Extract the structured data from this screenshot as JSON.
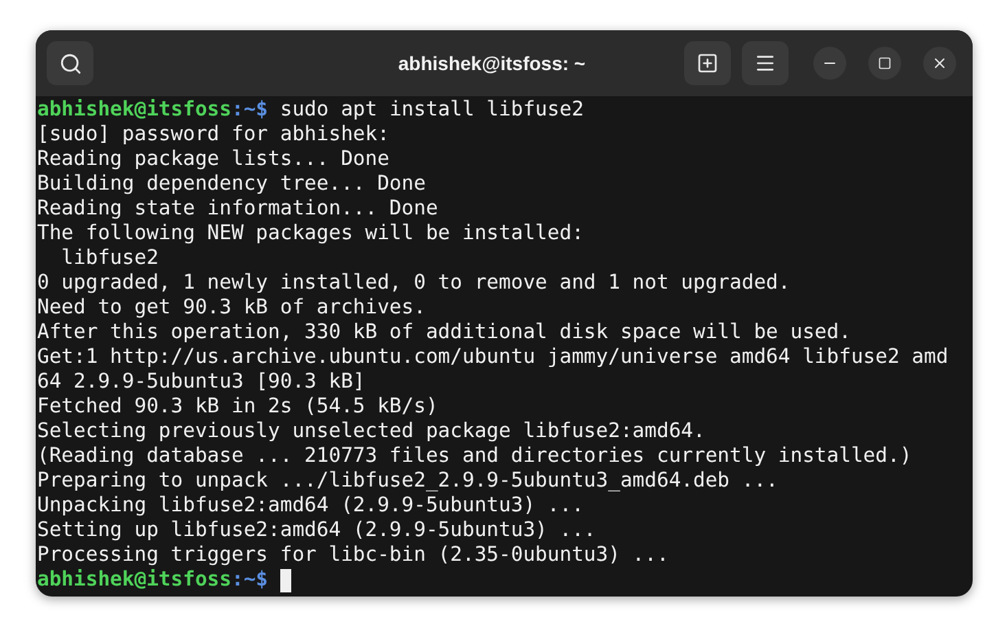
{
  "window": {
    "title": "abhishek@itsfoss: ~"
  },
  "terminal": {
    "lines": [
      {
        "kind": "prompt",
        "user_host": "abhishek@itsfoss",
        "path": ":~$",
        "command": " sudo apt install libfuse2",
        "cursor": false
      },
      {
        "kind": "output",
        "text": "[sudo] password for abhishek:"
      },
      {
        "kind": "output",
        "text": "Reading package lists... Done"
      },
      {
        "kind": "output",
        "text": "Building dependency tree... Done"
      },
      {
        "kind": "output",
        "text": "Reading state information... Done"
      },
      {
        "kind": "output",
        "text": "The following NEW packages will be installed:"
      },
      {
        "kind": "output",
        "text": "  libfuse2"
      },
      {
        "kind": "output",
        "text": "0 upgraded, 1 newly installed, 0 to remove and 1 not upgraded."
      },
      {
        "kind": "output",
        "text": "Need to get 90.3 kB of archives."
      },
      {
        "kind": "output",
        "text": "After this operation, 330 kB of additional disk space will be used."
      },
      {
        "kind": "output",
        "text": "Get:1 http://us.archive.ubuntu.com/ubuntu jammy/universe amd64 libfuse2 amd"
      },
      {
        "kind": "output",
        "text": "64 2.9.9-5ubuntu3 [90.3 kB]"
      },
      {
        "kind": "output",
        "text": "Fetched 90.3 kB in 2s (54.5 kB/s)"
      },
      {
        "kind": "output",
        "text": "Selecting previously unselected package libfuse2:amd64."
      },
      {
        "kind": "output",
        "text": "(Reading database ... 210773 files and directories currently installed.)"
      },
      {
        "kind": "output",
        "text": "Preparing to unpack .../libfuse2_2.9.9-5ubuntu3_amd64.deb ..."
      },
      {
        "kind": "output",
        "text": "Unpacking libfuse2:amd64 (2.9.9-5ubuntu3) ..."
      },
      {
        "kind": "output",
        "text": "Setting up libfuse2:amd64 (2.9.9-5ubuntu3) ..."
      },
      {
        "kind": "output",
        "text": "Processing triggers for libc-bin (2.35-0ubuntu3) ..."
      },
      {
        "kind": "prompt",
        "user_host": "abhishek@itsfoss",
        "path": ":~$",
        "cursor": true
      }
    ]
  }
}
